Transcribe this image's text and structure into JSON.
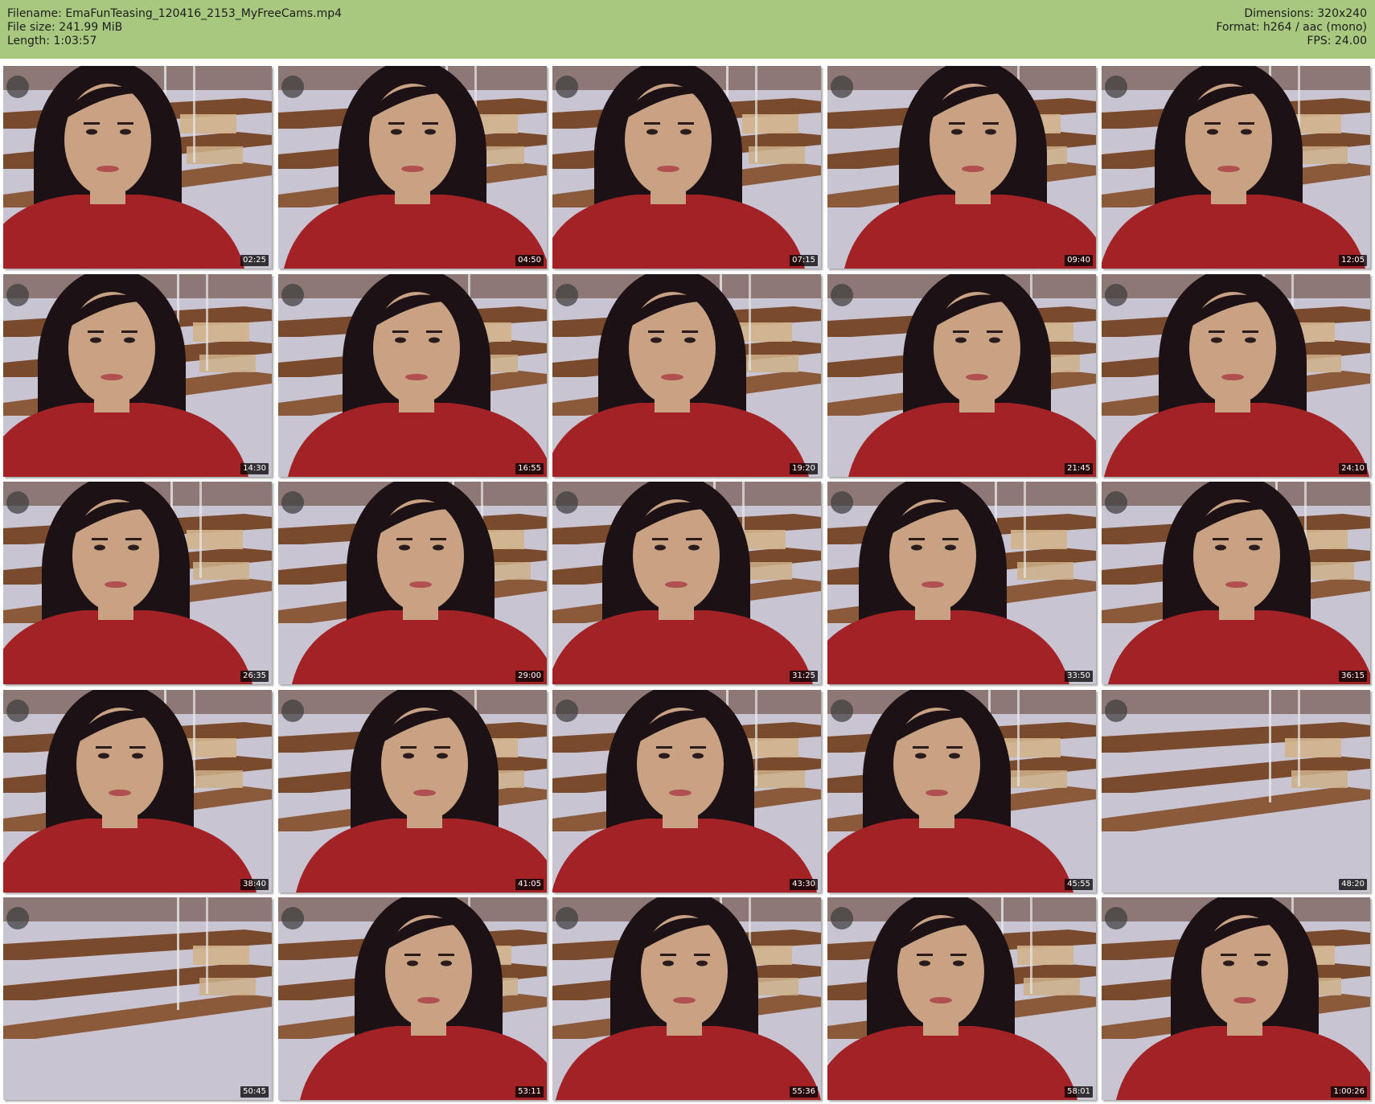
{
  "header": {
    "filename_label": "Filename:",
    "filename": "EmaFunTeasing_120416_2153_MyFreeCams.mp4",
    "filesize_label": "File size:",
    "filesize": "241.99 MiB",
    "length_label": "Length:",
    "length": "1:03:57",
    "dimensions_label": "Dimensions:",
    "dimensions": "320x240",
    "format_label": "Format:",
    "format": "h264 / aac (mono)",
    "fps_label": "FPS:",
    "fps": "24.00"
  },
  "colors": {
    "header_bg": "#a9c87f",
    "wall": "#c9c4d2",
    "shelf": "#7a4a2c",
    "shirt": "#a32226",
    "hair": "#1c1216",
    "skin": "#c9a183"
  },
  "thumbnails": [
    {
      "timestamp": "02:25",
      "person": true
    },
    {
      "timestamp": "04:50",
      "person": true
    },
    {
      "timestamp": "07:15",
      "person": true
    },
    {
      "timestamp": "09:40",
      "person": true
    },
    {
      "timestamp": "12:05",
      "person": true
    },
    {
      "timestamp": "14:30",
      "person": true
    },
    {
      "timestamp": "16:55",
      "person": true
    },
    {
      "timestamp": "19:20",
      "person": true
    },
    {
      "timestamp": "21:45",
      "person": true
    },
    {
      "timestamp": "24:10",
      "person": true
    },
    {
      "timestamp": "26:35",
      "person": true
    },
    {
      "timestamp": "29:00",
      "person": true
    },
    {
      "timestamp": "31:25",
      "person": true
    },
    {
      "timestamp": "33:50",
      "person": true
    },
    {
      "timestamp": "36:15",
      "person": true
    },
    {
      "timestamp": "38:40",
      "person": true
    },
    {
      "timestamp": "41:05",
      "person": true
    },
    {
      "timestamp": "43:30",
      "person": true
    },
    {
      "timestamp": "45:55",
      "person": true
    },
    {
      "timestamp": "48:20",
      "person": false
    },
    {
      "timestamp": "50:45",
      "person": false
    },
    {
      "timestamp": "53:11",
      "person": true
    },
    {
      "timestamp": "55:36",
      "person": true
    },
    {
      "timestamp": "58:01",
      "person": true
    },
    {
      "timestamp": "1:00:26",
      "person": true
    }
  ]
}
